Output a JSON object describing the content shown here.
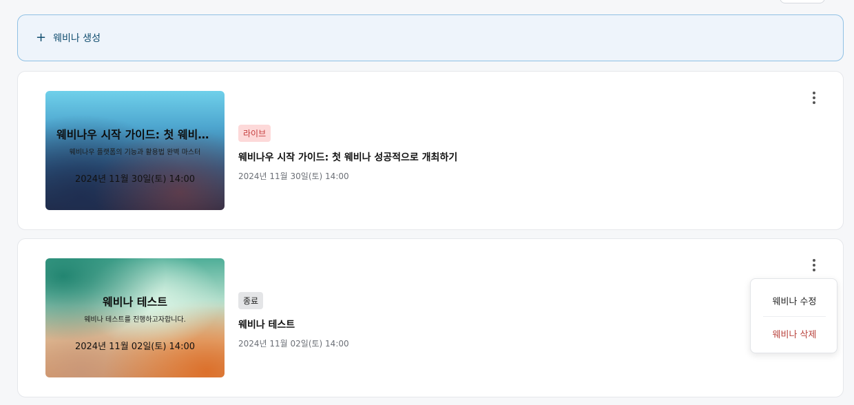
{
  "create": {
    "icon": "plus-icon",
    "label": "웨비나 생성"
  },
  "webinars": [
    {
      "thumbnail": {
        "title": "웨비나우 시작 가이드: 첫 웨비나 성공적으로 개최하기",
        "subtitle": "웨비나우 플랫폼의 기능과 활용법 완벽 마스터",
        "date": "2024년 11월 30일(토) 14:00"
      },
      "status": "라이브",
      "title": "웨비나우 시작 가이드: 첫 웨비나 성공적으로 개최하기",
      "date": "2024년 11월 30일(토) 14:00"
    },
    {
      "thumbnail": {
        "title": "웨비나 테스트",
        "subtitle": "웨비나 테스트를 진행하고자합니다.",
        "date": "2024년 11월 02일(토) 14:00"
      },
      "status": "종료",
      "title": "웨비나 테스트",
      "date": "2024년 11월 02일(토) 14:00"
    }
  ],
  "menu": {
    "edit": "웨비나 수정",
    "delete": "웨비나 삭제"
  },
  "colors": {
    "live_badge": "#fdd9d9",
    "ended_badge": "#e4e5e7",
    "delete_text": "#b8413b",
    "create_border": "#8fc0e4"
  }
}
